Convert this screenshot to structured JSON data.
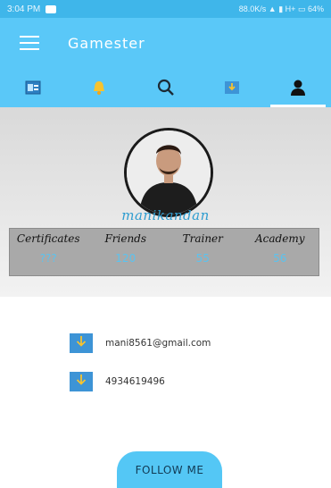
{
  "status_bar": {
    "time": "3:04 PM",
    "network": "88.0K/s",
    "carrier": "H+",
    "battery": "64%"
  },
  "toolbar": {
    "title": "Gamester"
  },
  "tabs": [
    {
      "icon": "id-card-icon",
      "active": false
    },
    {
      "icon": "bell-icon",
      "active": false
    },
    {
      "icon": "search-icon",
      "active": false
    },
    {
      "icon": "download-icon",
      "active": false
    },
    {
      "icon": "person-icon",
      "active": true
    }
  ],
  "profile": {
    "username": "manikandan",
    "stats": [
      {
        "label": "Certificates",
        "value": "???"
      },
      {
        "label": "Friends",
        "value": "120"
      },
      {
        "label": "Trainer",
        "value": "55"
      },
      {
        "label": "Academy",
        "value": "56"
      }
    ]
  },
  "contact": {
    "email": "mani8561@gmail.com",
    "phone": "4934619496",
    "icon": "download-icon"
  },
  "follow_button": {
    "label": "FOLLOW ME"
  },
  "colors": {
    "primary": "#5ac8f8",
    "status_bar": "#3fb6ea",
    "accent_text": "#2f9dd0",
    "stats_panel": "#a9a9a9",
    "contact_icon": "#3d94d6"
  }
}
